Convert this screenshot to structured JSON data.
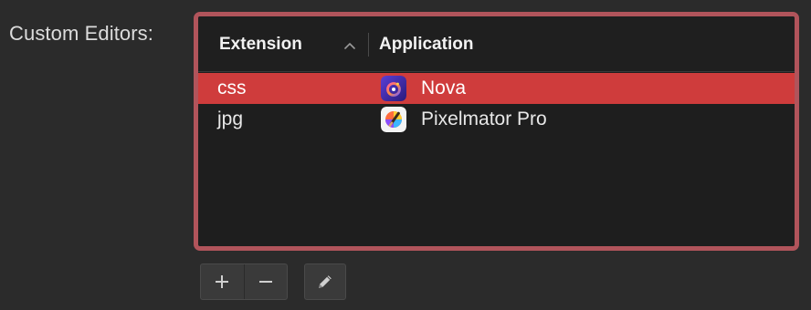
{
  "label": "Custom Editors:",
  "table": {
    "columns": [
      "Extension",
      "Application"
    ],
    "sort_column": "Extension",
    "sort_direction": "ascending",
    "rows": [
      {
        "extension": "css",
        "application": "Nova",
        "selected": true
      },
      {
        "extension": "jpg",
        "application": "Pixelmator Pro",
        "selected": false
      }
    ]
  },
  "buttons": {
    "add": "+",
    "remove": "−",
    "edit": "pencil-icon"
  },
  "colors": {
    "selection": "#cf3c3c",
    "focus_ring": "#b1545b"
  }
}
